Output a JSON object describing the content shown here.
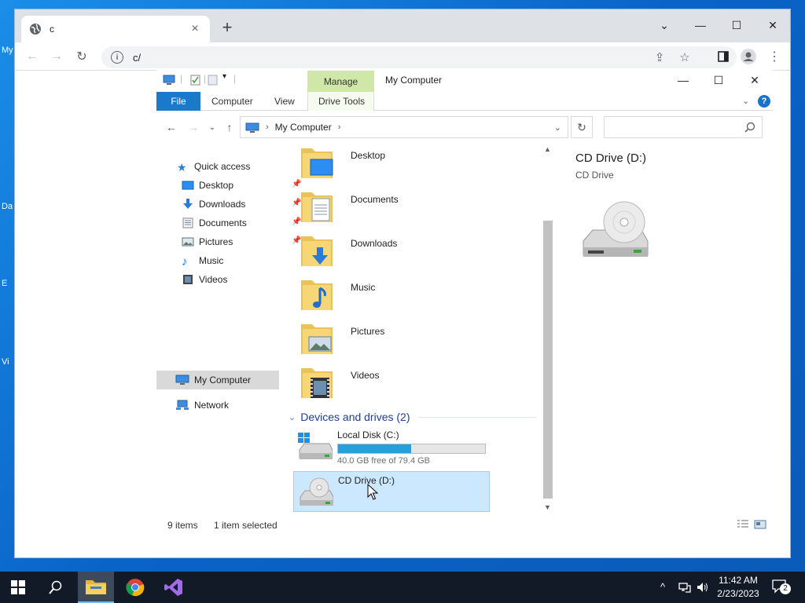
{
  "desktop": {
    "labels": [
      "My",
      "Da",
      "E",
      "Vi"
    ]
  },
  "browser": {
    "tab_title": "c",
    "tab_close": "×",
    "new_tab": "+",
    "url": "c/",
    "window_controls": {
      "minimize": "—",
      "maximize": "☐",
      "close": "✕",
      "tabsearch": "⌄"
    }
  },
  "explorer": {
    "title": "My Computer",
    "manage_tab": "Manage",
    "ribbon_tabs": [
      "File",
      "Computer",
      "View",
      "Drive Tools"
    ],
    "help": "?",
    "address": {
      "crumb": "My Computer"
    },
    "nav": {
      "quick_access": "Quick access",
      "pinned": [
        {
          "label": "Desktop",
          "pinned": true
        },
        {
          "label": "Downloads",
          "pinned": true
        },
        {
          "label": "Documents",
          "pinned": true
        },
        {
          "label": "Pictures",
          "pinned": true
        },
        {
          "label": "Music",
          "pinned": false
        },
        {
          "label": "Videos",
          "pinned": false
        }
      ],
      "my_computer": "My Computer",
      "network": "Network"
    },
    "folders": [
      "Desktop",
      "Documents",
      "Downloads",
      "Music",
      "Pictures",
      "Videos"
    ],
    "devices_group": "Devices and drives (2)",
    "drives": [
      {
        "name": "Local Disk (C:)",
        "free_text": "40.0 GB free of 79.4 GB",
        "used_fraction": 0.496
      },
      {
        "name": "CD Drive (D:)"
      }
    ],
    "preview": {
      "title": "CD Drive (D:)",
      "subtitle": "CD Drive"
    },
    "status": {
      "items": "9 items",
      "selected": "1 item selected"
    }
  },
  "taskbar": {
    "time": "11:42 AM",
    "date": "2/23/2023",
    "notifications": "2"
  },
  "colors": {
    "accent": "#1979ca",
    "manage_tab": "#cfe8a7",
    "selection": "#cce8ff",
    "progress": "#26a0da"
  }
}
